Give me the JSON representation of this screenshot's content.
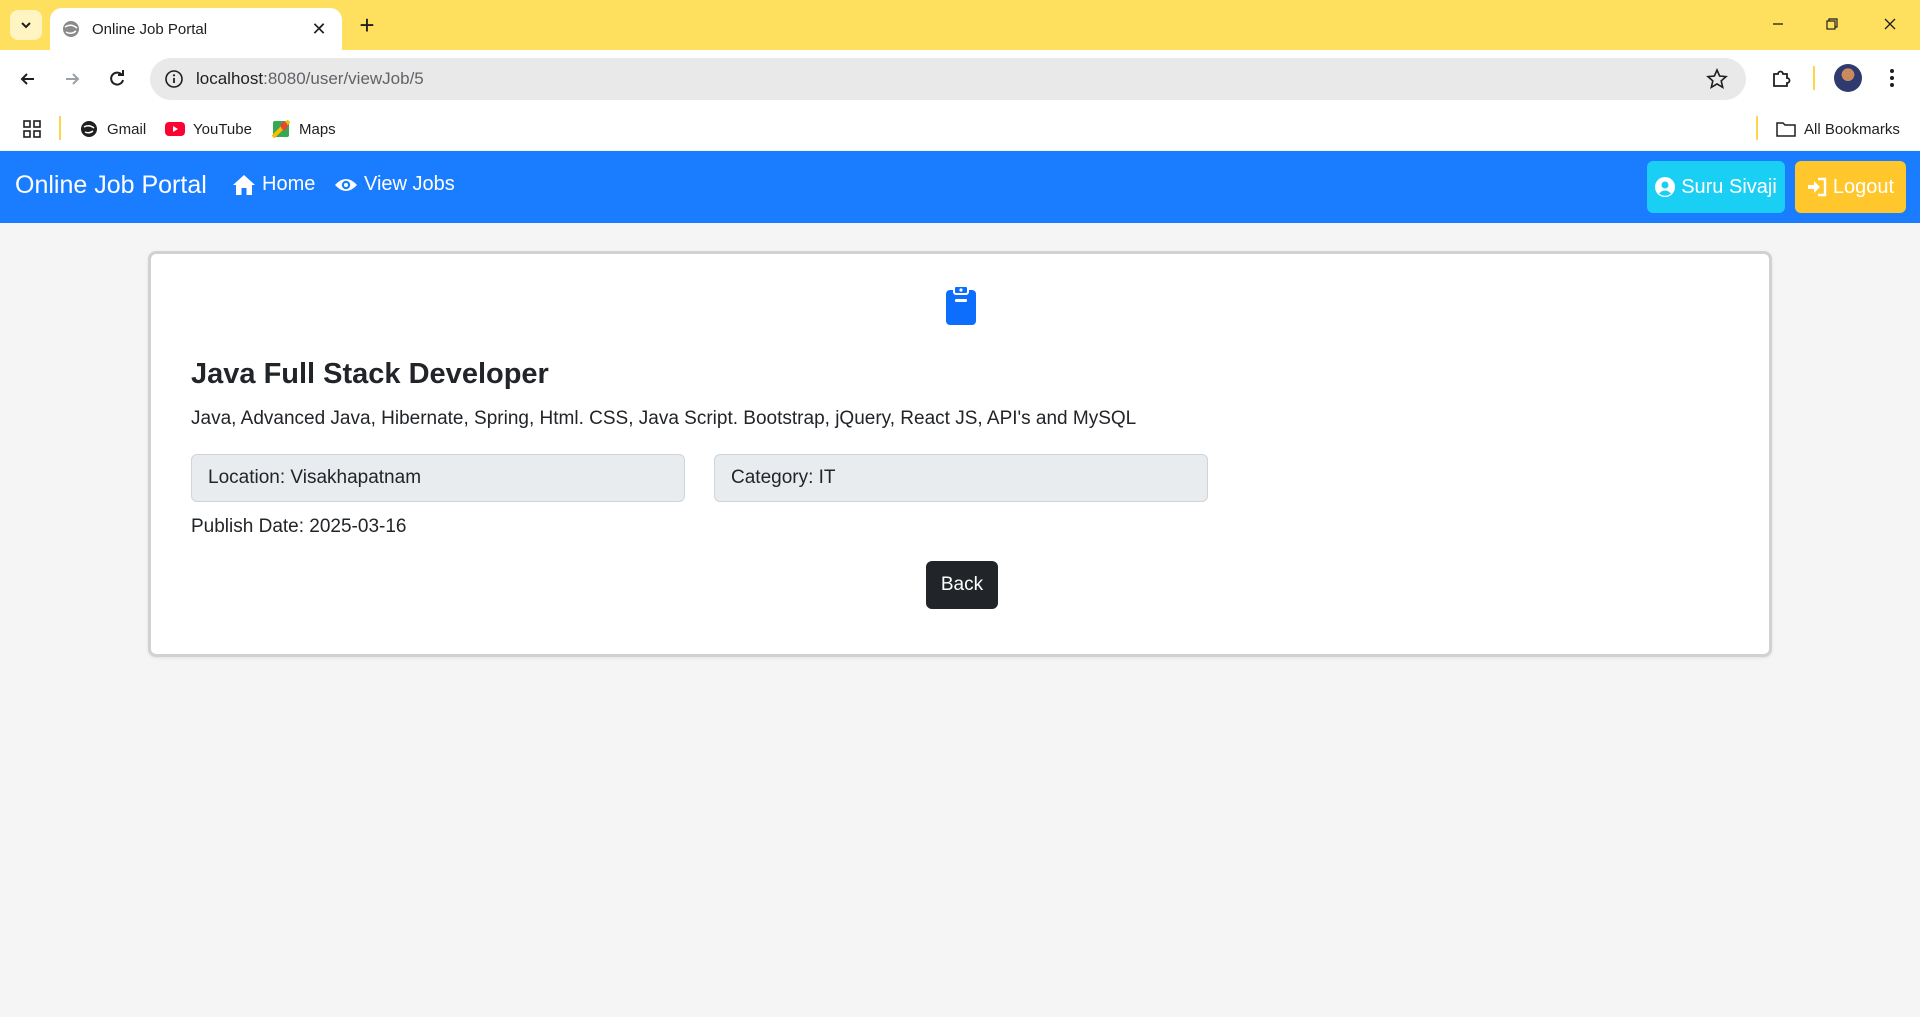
{
  "browser": {
    "tab_title": "Online Job Portal",
    "new_tab_symbol": "+",
    "close_symbol": "✕",
    "url_host": "localhost",
    "url_path": ":8080/user/viewJob/5",
    "bookmarks": [
      {
        "label": "Gmail",
        "icon": "gmail-icon"
      },
      {
        "label": "YouTube",
        "icon": "youtube-icon"
      },
      {
        "label": "Maps",
        "icon": "maps-icon"
      }
    ],
    "all_bookmarks_label": "All Bookmarks",
    "theme_color": "#ffdf5e"
  },
  "navbar": {
    "brand": "Online Job Portal",
    "home_label": "Home",
    "view_jobs_label": "View Jobs",
    "user_label": "Suru Sivaji",
    "logout_label": "Logout",
    "bg_color": "#1a7dff",
    "user_btn_color": "#19cff3",
    "logout_btn_color": "#ffc72c"
  },
  "job": {
    "icon": "clipboard-icon",
    "title": "Java Full Stack Developer",
    "description": "Java, Advanced Java, Hibernate, Spring, Html. CSS, Java Script. Bootstrap, jQuery, React JS, API's and MySQL",
    "location": "Location: Visakhapatnam",
    "category": "Category: IT",
    "publish_date": "Publish Date: 2025-03-16",
    "back_label": "Back"
  }
}
